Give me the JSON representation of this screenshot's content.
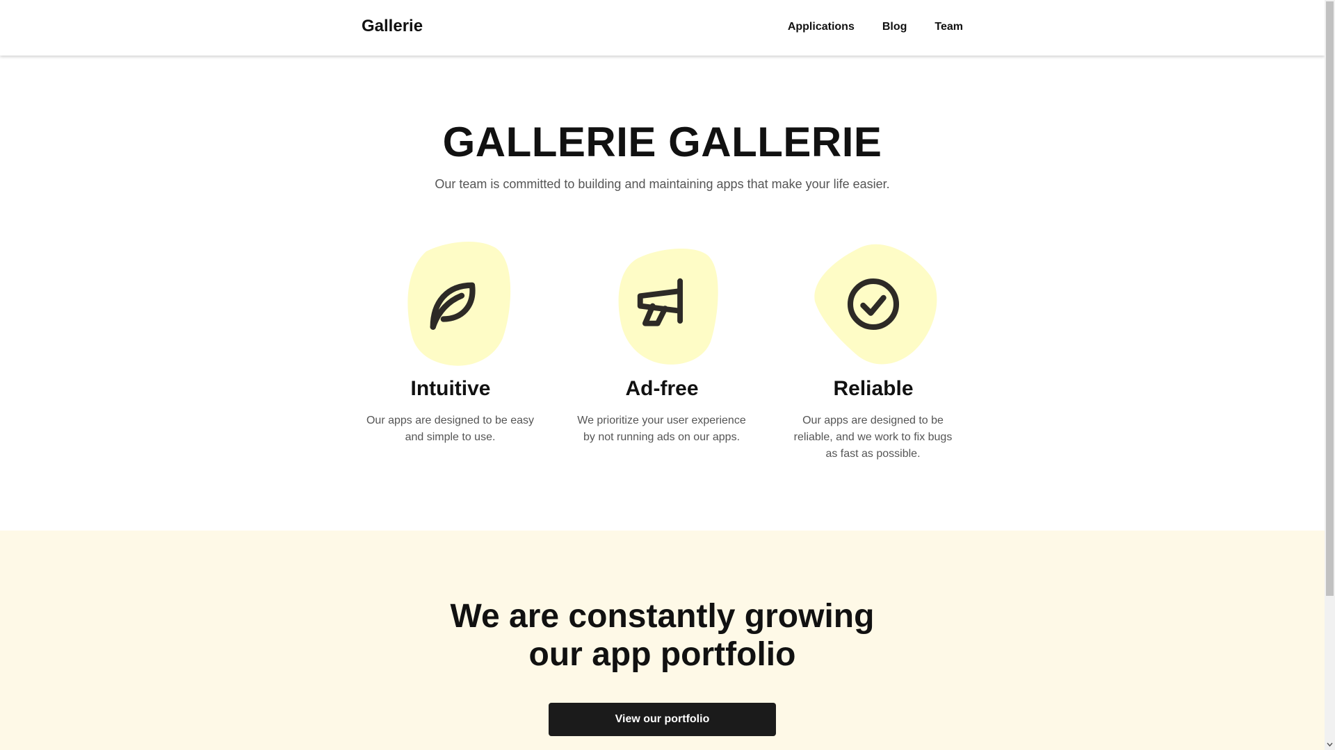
{
  "header": {
    "brand": "Gallerie",
    "nav": [
      "Applications",
      "Blog",
      "Team"
    ]
  },
  "hero": {
    "title": "GALLERIE GALLERIE",
    "subtitle": "Our team is committed to building and maintaining apps that make your life easier."
  },
  "features": [
    {
      "icon": "leaf-icon",
      "title": "Intuitive",
      "text": "Our apps are designed to be easy and simple to use."
    },
    {
      "icon": "megaphone-icon",
      "title": "Ad-free",
      "text": "We prioritize your user experience by not running ads on our apps."
    },
    {
      "icon": "check-circle-icon",
      "title": "Reliable",
      "text": "Our apps are designed to be reliable, and we work to fix bugs as fast as possible."
    }
  ],
  "portfolio": {
    "heading_line1": "We are constantly growing",
    "heading_line2": "our app portfolio",
    "cta": "View our portfolio"
  },
  "colors": {
    "blob": "#fefcc6",
    "icon": "#2d2a26",
    "section_bg": "#fef9e7",
    "button_bg": "#1b1b1b"
  }
}
